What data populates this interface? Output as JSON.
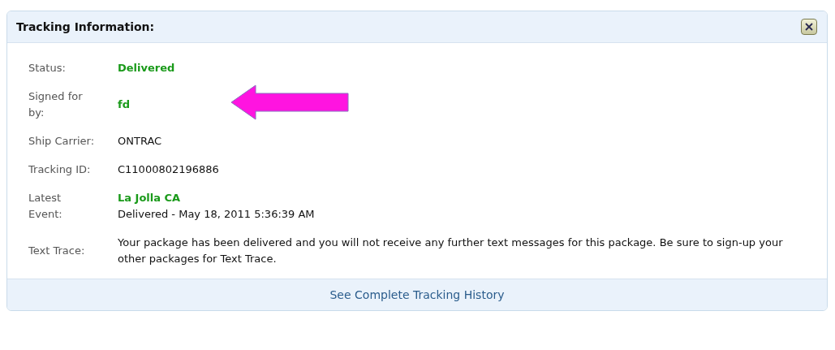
{
  "panel": {
    "title": "Tracking Information:"
  },
  "rows": [
    {
      "label": "Status:",
      "values": [
        {
          "text": "Delivered",
          "kind": "highlight"
        }
      ]
    },
    {
      "label": "Signed for by:",
      "values": [
        {
          "text": "fd",
          "kind": "highlight"
        }
      ],
      "pointer": true
    },
    {
      "label": "Ship Carrier:",
      "values": [
        {
          "text": "ONTRAC",
          "kind": "plain"
        }
      ]
    },
    {
      "label": "Tracking ID:",
      "values": [
        {
          "text": "C11000802196886",
          "kind": "plain"
        }
      ]
    },
    {
      "label": "Latest Event:",
      "values": [
        {
          "text": "La Jolla CA",
          "kind": "highlight"
        },
        {
          "text": "Delivered - May 18, 2011 5:36:39 AM",
          "kind": "plain"
        }
      ]
    },
    {
      "label": "Text Trace:",
      "values": [
        {
          "text": "Your package has been delivered and you will not receive any further text messages for this package. Be sure to sign-up your other packages for Text Trace.",
          "kind": "plain"
        }
      ]
    }
  ],
  "footer_link": "See Complete Tracking History"
}
